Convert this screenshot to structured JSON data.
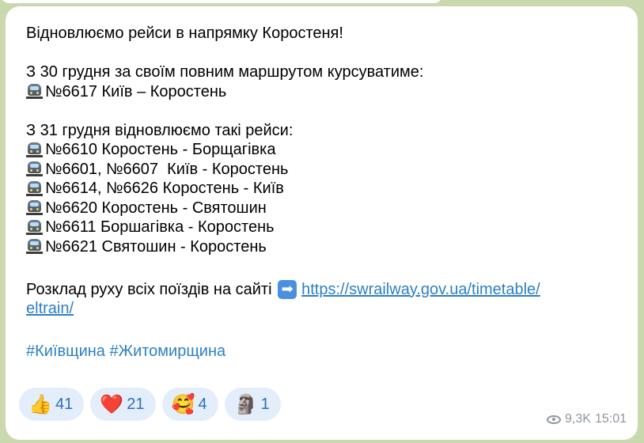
{
  "message": {
    "line1": "Відновлюємо рейси в напрямку Коростеня!",
    "line2": "З 30 грудня за своїм повним маршрутом курсуватиме:",
    "line3": "№6617 Київ – Коростень",
    "line4": "З 31 грудня відновлюємо такі рейси:",
    "routes": [
      "№6610 Коростень - Борщагівка",
      "№6601, №6607  Київ - Коростень",
      "№6614, №6626 Коростень - Київ",
      "№6620 Коростень - Святошин",
      "№6611 Боршагівка - Коростень",
      "№6621 Святошин - Коростень"
    ],
    "schedule_text": "Розклад руху всіх поїздів на сайті",
    "link_part1": "https://swrailway.gov.ua/timetable/",
    "link_part2": "eltrain/",
    "hashtag1": "#Київщина",
    "hashtag2": "#Житомирщина"
  },
  "icons": {
    "route_icon": "train-icon",
    "link_icon": "right-arrow-icon",
    "arrow_glyph": "➡"
  },
  "reactions": [
    {
      "emoji": "👍",
      "count": "41"
    },
    {
      "emoji": "❤️",
      "count": "21"
    },
    {
      "emoji": "🥰",
      "count": "4"
    },
    {
      "emoji": "🗿",
      "count": "1"
    }
  ],
  "meta": {
    "views": "9,3K",
    "time": "15:01"
  },
  "colors": {
    "link": "#2d7fc4",
    "reaction_bg": "#e4eefa",
    "reaction_count": "#2d6fb8",
    "meta_text": "#8e969e",
    "chat_bg": "#c9d8ad"
  }
}
